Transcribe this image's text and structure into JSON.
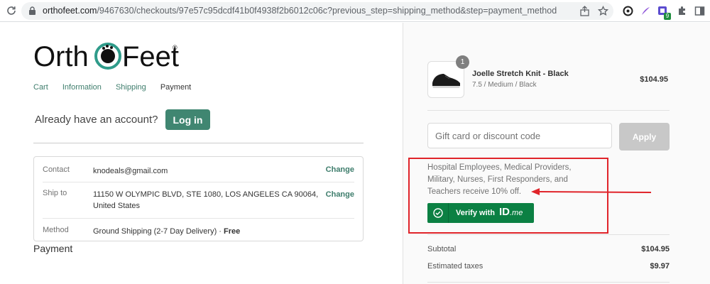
{
  "browser": {
    "url_host": "orthofeet.com",
    "url_path": "/9467630/checkouts/97e57c95dcdf41b0f4938f2b6012c06c?previous_step=shipping_method&step=payment_method",
    "extension_badge": "9",
    "icons": [
      "reload-icon",
      "lock-icon",
      "share-icon",
      "star-icon",
      "extension-icon",
      "puzzle-icon",
      "sidepanel-icon",
      "menu-icon"
    ]
  },
  "logo": {
    "text_left": "Orth",
    "text_right": "Feet",
    "reg": "®"
  },
  "breadcrumb": {
    "cart": "Cart",
    "information": "Information",
    "shipping": "Shipping",
    "payment": "Payment"
  },
  "account": {
    "prompt": "Already have an account?",
    "login": "Log in"
  },
  "review": {
    "contact_label": "Contact",
    "contact_value": "knodeals@gmail.com",
    "contact_change": "Change",
    "ship_label": "Ship to",
    "ship_value": "11150 W OLYMPIC BLVD, STE 1080, LOS ANGELES CA 90064, United States",
    "ship_change": "Change",
    "method_label": "Method",
    "method_value": "Ground Shipping (2-7 Day Delivery) · ",
    "method_price": "Free"
  },
  "payment_heading": "Payment",
  "order": {
    "quantity": "1",
    "product_name": "Joelle Stretch Knit - Black",
    "variant": "7.5 / Medium / Black",
    "price": "$104.95",
    "gift_placeholder": "Gift card or discount code",
    "apply": "Apply",
    "idme_text": "Hospital Employees, Medical Providers, Military, Nurses, First Responders, and Teachers receive 10% off.",
    "idme_button_label": "Verify with",
    "idme_brand": "ID",
    "idme_brand_suffix": ".me",
    "subtotal_label": "Subtotal",
    "subtotal": "$104.95",
    "taxes_label": "Estimated taxes",
    "taxes": "$9.97"
  },
  "colors": {
    "accent": "#408671",
    "link": "#3e7d6c",
    "idme_green": "#0b8043",
    "highlight_red": "#e0242a"
  }
}
